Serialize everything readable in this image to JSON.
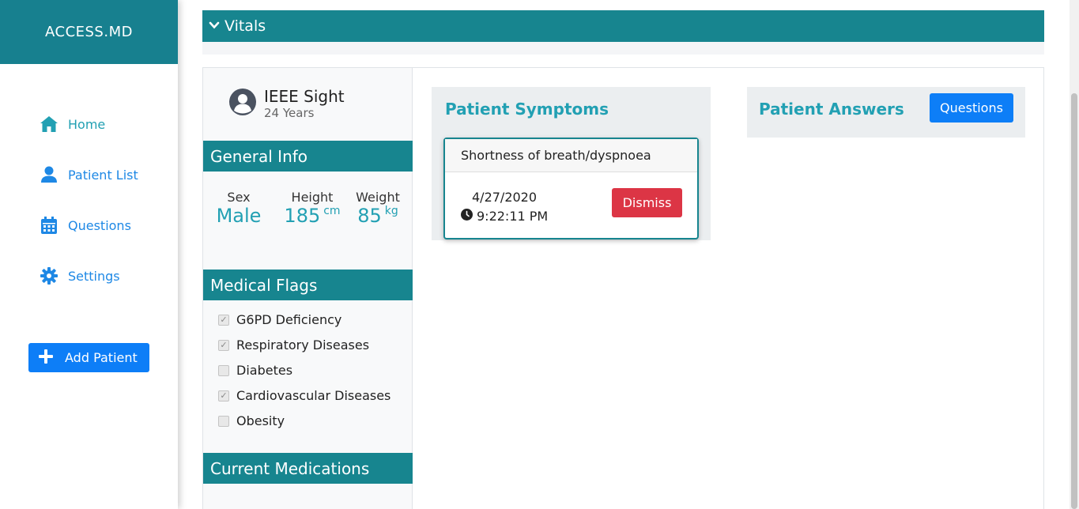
{
  "app": {
    "brand": "ACCESS.MD"
  },
  "sidebar": {
    "items": [
      {
        "label": "Home",
        "icon": "home-icon"
      },
      {
        "label": "Patient List",
        "icon": "user-icon"
      },
      {
        "label": "Questions",
        "icon": "calendar-icon"
      },
      {
        "label": "Settings",
        "icon": "gear-icon"
      }
    ],
    "add_patient_label": "Add Patient"
  },
  "vitals": {
    "label": "Vitals"
  },
  "patient": {
    "name": "IEEE Sight",
    "age": "24 Years"
  },
  "general_info": {
    "title": "General Info",
    "sex_label": "Sex",
    "sex_value": "Male",
    "height_label": "Height",
    "height_value": "185",
    "height_unit": "cm",
    "weight_label": "Weight",
    "weight_value": "85",
    "weight_unit": "kg"
  },
  "medical_flags": {
    "title": "Medical Flags",
    "items": [
      {
        "label": "G6PD Deficiency",
        "checked": true
      },
      {
        "label": "Respiratory Diseases",
        "checked": true
      },
      {
        "label": "Diabetes",
        "checked": false
      },
      {
        "label": "Cardiovascular Diseases",
        "checked": true
      },
      {
        "label": "Obesity",
        "checked": false
      }
    ]
  },
  "current_medications": {
    "title": "Current Medications"
  },
  "symptoms": {
    "title": "Patient Symptoms",
    "card": {
      "symptom": "Shortness of breath/dyspnoea",
      "date": "4/27/2020",
      "time": "9:22:11 PM",
      "dismiss_label": "Dismiss"
    }
  },
  "answers": {
    "title": "Patient Answers",
    "questions_label": "Questions"
  },
  "colors": {
    "teal": "#17858f",
    "accent": "#22a0b3",
    "primary": "#0d7ef7",
    "danger": "#dc3545"
  }
}
